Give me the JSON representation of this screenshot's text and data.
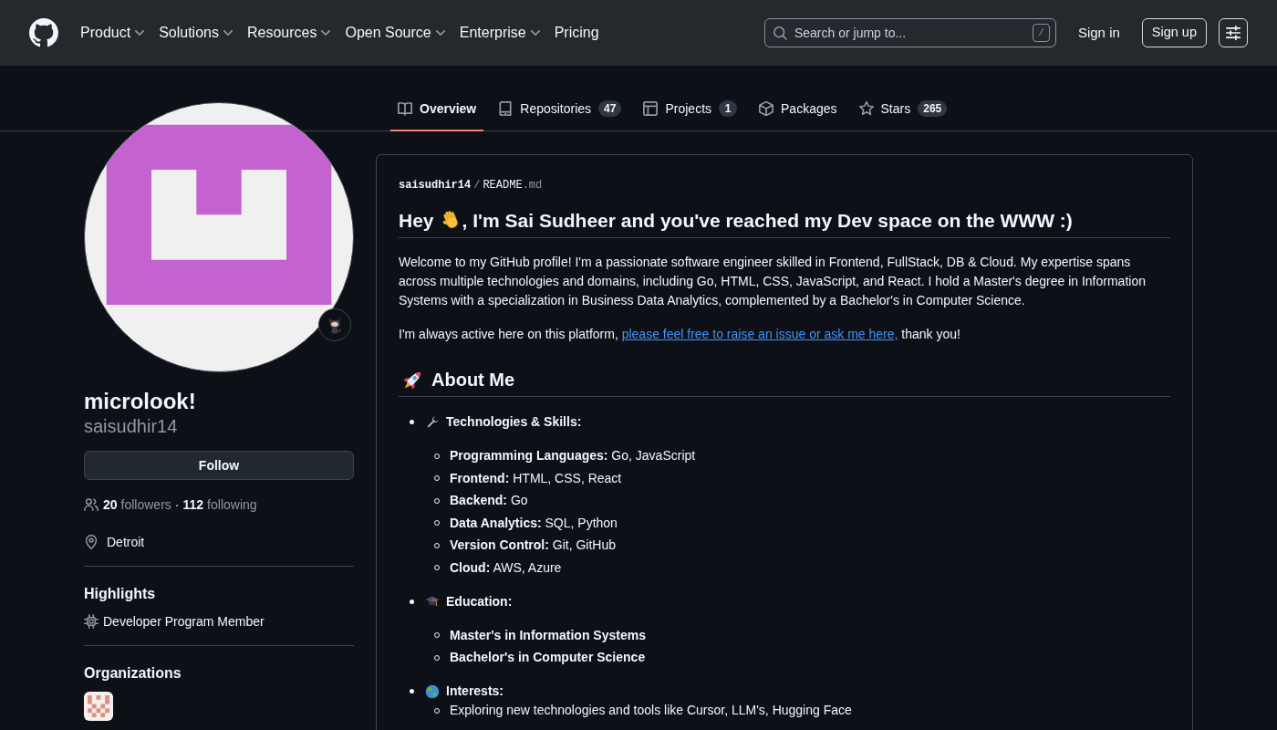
{
  "header": {
    "nav": [
      {
        "label": "Product",
        "has_menu": true
      },
      {
        "label": "Solutions",
        "has_menu": true
      },
      {
        "label": "Resources",
        "has_menu": true
      },
      {
        "label": "Open Source",
        "has_menu": true
      },
      {
        "label": "Enterprise",
        "has_menu": true
      },
      {
        "label": "Pricing",
        "has_menu": false
      }
    ],
    "search": {
      "placeholder": "Search or jump to...",
      "shortcut": "/"
    },
    "sign_in": "Sign in",
    "sign_up": "Sign up"
  },
  "tabs": [
    {
      "label": "Overview",
      "selected": true
    },
    {
      "label": "Repositories",
      "count": "47",
      "selected": false
    },
    {
      "label": "Projects",
      "count": "1",
      "selected": false
    },
    {
      "label": "Packages",
      "selected": false
    },
    {
      "label": "Stars",
      "count": "265",
      "selected": false
    }
  ],
  "profile": {
    "display_name": "microlook!",
    "username": "saisudhir14",
    "follow_button": "Follow",
    "followers": {
      "count": "20",
      "label": "followers"
    },
    "separator": "·",
    "following": {
      "count": "112",
      "label": "following"
    },
    "location": "Detroit",
    "highlights": {
      "title": "Highlights",
      "items": [
        "Developer Program Member"
      ]
    },
    "organizations": {
      "title": "Organizations"
    }
  },
  "readme": {
    "path": {
      "owner": "saisudhir14",
      "separator": "/",
      "file": "README",
      "extension": ".md"
    },
    "greeting": {
      "lead": "Hey",
      "rest": ", I'm Sai Sudheer and you've reached my Dev space on the WWW :)"
    },
    "intro": "Welcome to my GitHub profile! I'm a passionate software engineer skilled in Frontend, FullStack, DB & Cloud. My expertise spans across multiple technologies and domains, including Go, HTML, CSS, JavaScript, and React. I hold a Master's degree in Information Systems with a specialization in Business Data Analytics, complemented by a Bachelor's in Computer Science.",
    "contact": {
      "before": "I'm always active here on this platform, ",
      "link": "please feel free to raise an issue or ask me here,",
      "after": " thank you!"
    },
    "about_heading": "About Me",
    "sections": [
      {
        "label": "Technologies & Skills:",
        "kind": "loose",
        "children": [
          {
            "text": "**Programming Languages:** Go, JavaScript",
            "bold": false
          },
          {
            "text": "**Frontend:** HTML, CSS, React",
            "bold": false
          },
          {
            "text": "**Backend:** Go",
            "bold": false
          },
          {
            "text": "**Data Analytics:** SQL, Python",
            "bold": false
          },
          {
            "text": "**Version Control:** Git, GitHub",
            "bold": false
          },
          {
            "text": "**Cloud:** AWS, Azure",
            "bold": false
          }
        ]
      },
      {
        "label": "Education:",
        "kind": "loose",
        "children": [
          {
            "text": "Master's in Information Systems",
            "bold": true
          },
          {
            "text": "Bachelor's in Computer Science",
            "bold": true
          }
        ]
      },
      {
        "label": "Interests:",
        "kind": "tight",
        "children": [
          {
            "text": "Exploring new technologies and tools like Cursor, LLM's, Hugging Face",
            "bold": false
          }
        ]
      }
    ]
  }
}
